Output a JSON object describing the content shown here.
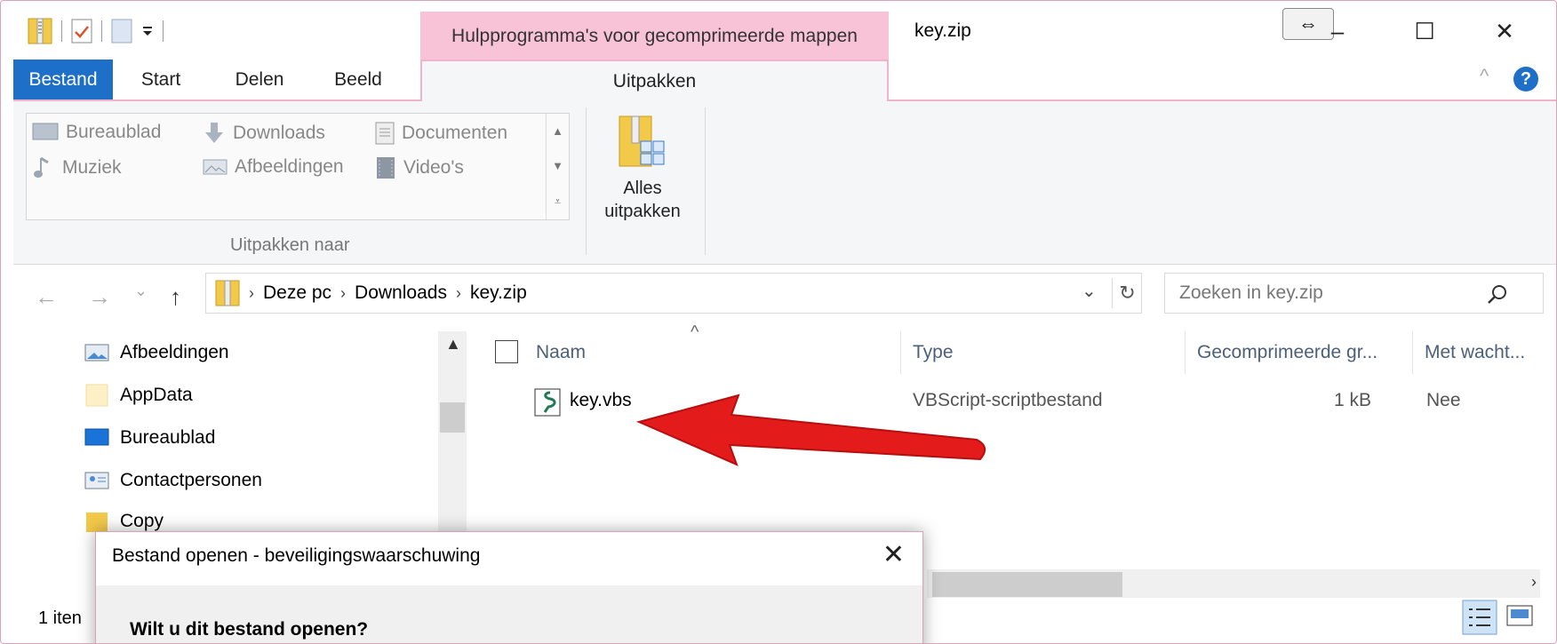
{
  "window": {
    "title": "key.zip",
    "context_tab": "Hulpprogramma's voor gecomprimeerde mappen",
    "minimize": "–",
    "maximize": "☐",
    "close": "✕",
    "resize_glyph": "⇔"
  },
  "ribbon": {
    "tabs": [
      "Bestand",
      "Start",
      "Delen",
      "Beeld"
    ],
    "active_tab": "Uitpakken",
    "collapse": "^",
    "help": "?",
    "destinations": [
      "Bureaublad",
      "Downloads",
      "Documenten",
      "Muziek",
      "Afbeeldingen",
      "Video's"
    ],
    "group_label": "Uitpakken naar",
    "extract_all_line1": "Alles",
    "extract_all_line2": "uitpakken"
  },
  "navigation": {
    "back": "←",
    "forward": "→",
    "recent": "⌄",
    "up": "↑"
  },
  "address": {
    "crumbs": [
      "Deze pc",
      "Downloads",
      "key.zip"
    ],
    "dropdown": "⌄",
    "refresh": "↻"
  },
  "search": {
    "placeholder": "Zoeken in key.zip",
    "icon": "⌕"
  },
  "tree": {
    "items": [
      "Afbeeldingen",
      "AppData",
      "Bureaublad",
      "Contactpersonen",
      "Copy"
    ]
  },
  "columns": {
    "sort_indicator": "^",
    "name": "Naam",
    "type": "Type",
    "compressed": "Gecomprimeerde gr...",
    "password": "Met wacht..."
  },
  "files": [
    {
      "name": "key.vbs",
      "type": "VBScript-scriptbestand",
      "size": "1 kB",
      "password": "Nee"
    }
  ],
  "status": {
    "items": "1 iten"
  },
  "dialog": {
    "title": "Bestand openen - beveiligingswaarschuwing",
    "question": "Wilt u dit bestand openen?",
    "close": "✕"
  },
  "colors": {
    "accent": "#1e6fc8",
    "context_pink": "#f9c3d7",
    "arrow_red": "#e31b1b"
  },
  "icons": {
    "qat": [
      "zip-folder-icon",
      "properties-icon",
      "new-folder-icon",
      "customize-icon"
    ],
    "status_views": [
      "details-view-icon",
      "large-icons-view-icon"
    ]
  }
}
